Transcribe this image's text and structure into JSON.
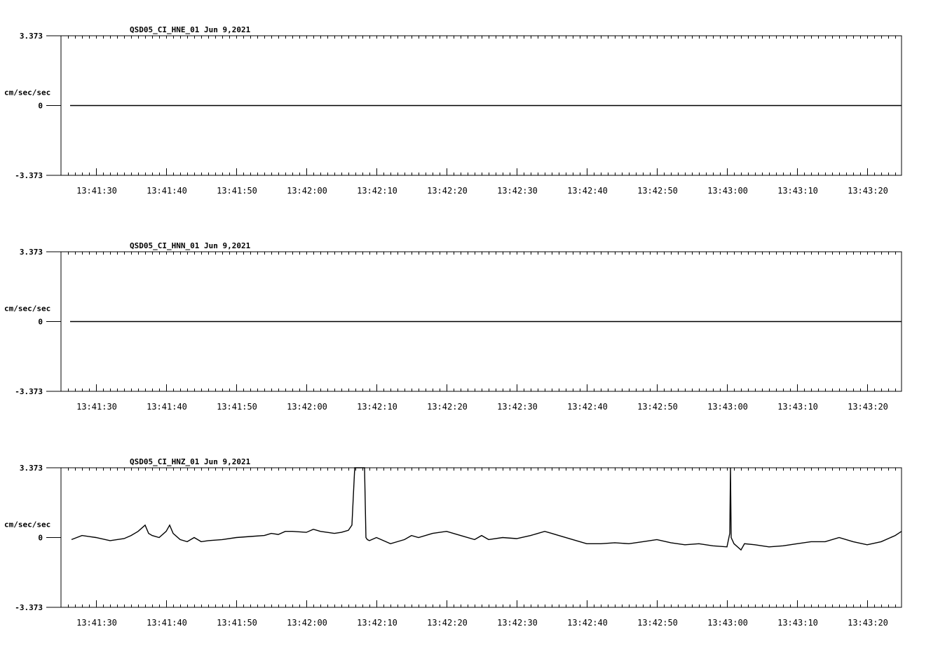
{
  "chart_data": [
    {
      "type": "line",
      "title": "QSD05_CI_HNE_01  Jun 9,2021",
      "ylabel": "cm/sec/sec",
      "ylim": [
        -3.373,
        3.373
      ],
      "yticks": [
        "3.373",
        "0",
        "-3.373"
      ],
      "xticks": [
        "13:41:30",
        "13:41:40",
        "13:41:50",
        "13:42:00",
        "13:42:10",
        "13:42:20",
        "13:42:30",
        "13:42:40",
        "13:42:50",
        "13:43:00",
        "13:43:10",
        "13:43:20"
      ],
      "x_start_seconds": 86.3,
      "x_end_seconds": 205,
      "grid": false,
      "series": [
        {
          "x": [
            86.3,
            205
          ],
          "y": [
            0,
            0
          ]
        }
      ]
    },
    {
      "type": "line",
      "title": "QSD05_CI_HNN_01  Jun 9,2021",
      "ylabel": "cm/sec/sec",
      "ylim": [
        -3.373,
        3.373
      ],
      "yticks": [
        "3.373",
        "0",
        "-3.373"
      ],
      "xticks": [
        "13:41:30",
        "13:41:40",
        "13:41:50",
        "13:42:00",
        "13:42:10",
        "13:42:20",
        "13:42:30",
        "13:42:40",
        "13:42:50",
        "13:43:00",
        "13:43:10",
        "13:43:20"
      ],
      "x_start_seconds": 86.3,
      "x_end_seconds": 205,
      "grid": false,
      "series": [
        {
          "x": [
            86.3,
            205
          ],
          "y": [
            0,
            0
          ]
        }
      ]
    },
    {
      "type": "line",
      "title": "QSD05_CI_HNZ_01  Jun 9,2021",
      "ylabel": "cm/sec/sec",
      "ylim": [
        -3.373,
        3.373
      ],
      "yticks": [
        "3.373",
        "0",
        "-3.373"
      ],
      "xticks": [
        "13:41:30",
        "13:41:40",
        "13:41:50",
        "13:42:00",
        "13:42:10",
        "13:42:20",
        "13:42:30",
        "13:42:40",
        "13:42:50",
        "13:43:00",
        "13:43:10",
        "13:43:20"
      ],
      "x_start_seconds": 86.3,
      "x_end_seconds": 205,
      "grid": false,
      "series": [
        {
          "x": [
            86.5,
            88,
            90,
            92,
            94,
            95,
            96,
            97,
            97.5,
            98,
            99,
            100,
            100.5,
            101,
            102,
            103,
            104,
            105,
            106,
            108,
            110,
            112,
            114,
            115,
            116,
            117,
            118,
            120,
            121,
            122,
            124,
            125,
            126,
            126.5,
            126.9,
            127,
            128.3,
            128.5,
            128.7,
            129,
            130,
            132,
            134,
            135,
            136,
            138,
            140,
            142,
            144,
            145,
            146,
            148,
            150,
            152,
            154,
            155,
            156,
            158,
            160,
            162,
            164,
            166,
            168,
            170,
            172,
            174,
            176,
            178,
            180,
            180.4,
            180.5,
            180.6,
            181,
            182,
            182.5,
            184,
            186,
            188,
            190,
            192,
            194,
            196,
            198,
            200,
            202,
            204,
            205
          ],
          "y": [
            -0.1,
            0.1,
            0.0,
            -0.15,
            -0.05,
            0.1,
            0.3,
            0.6,
            0.2,
            0.1,
            0.0,
            0.3,
            0.6,
            0.2,
            -0.1,
            -0.2,
            0.0,
            -0.2,
            -0.15,
            -0.1,
            0.0,
            0.05,
            0.1,
            0.2,
            0.15,
            0.3,
            0.3,
            0.25,
            0.4,
            0.3,
            0.2,
            0.25,
            0.35,
            0.6,
            3.373,
            3.373,
            3.373,
            0.0,
            -0.1,
            -0.15,
            0.0,
            -0.3,
            -0.1,
            0.1,
            0.0,
            0.2,
            0.3,
            0.1,
            -0.1,
            0.1,
            -0.1,
            0.0,
            -0.05,
            0.1,
            0.3,
            0.2,
            0.1,
            -0.1,
            -0.3,
            -0.3,
            -0.25,
            -0.3,
            -0.2,
            -0.1,
            -0.25,
            -0.35,
            -0.3,
            -0.4,
            -0.45,
            0.2,
            3.373,
            0.0,
            -0.3,
            -0.6,
            -0.3,
            -0.35,
            -0.45,
            -0.4,
            -0.3,
            -0.2,
            -0.2,
            0.0,
            -0.2,
            -0.35,
            -0.2,
            0.1,
            0.3
          ]
        }
      ]
    }
  ]
}
